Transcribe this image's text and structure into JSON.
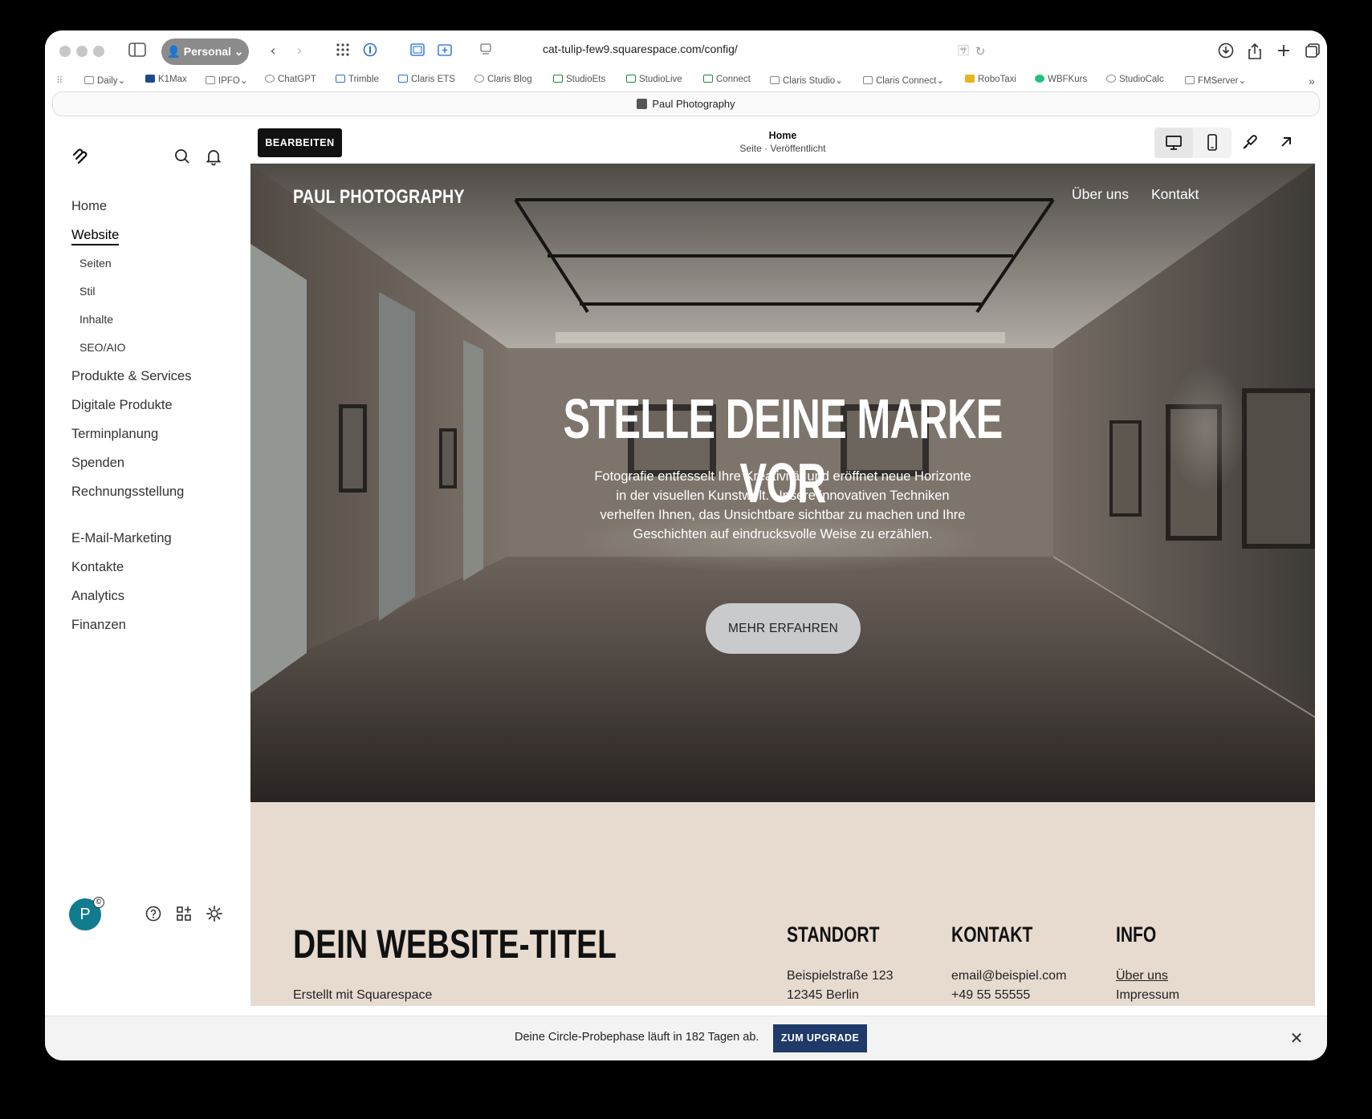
{
  "browser": {
    "profile_label": "Personal",
    "url": "cat-tulip-few9.squarespace.com/config/",
    "tab_title": "Paul Photography",
    "bookmarks": [
      "Daily",
      "K1Max",
      "IPFO",
      "ChatGPT",
      "Trimble",
      "Claris ETS",
      "Claris Blog",
      "StudioEts",
      "StudioLive",
      "Connect",
      "Claris Studio",
      "Claris Connect",
      "RoboTaxi",
      "WBFKurs",
      "StudioCalc",
      "FMServer"
    ]
  },
  "sidebar": {
    "items": [
      "Home",
      "Website",
      "Produkte & Services",
      "Digitale Produkte",
      "Terminplanung",
      "Spenden",
      "Rechnungsstellung",
      "E-Mail-Marketing",
      "Kontakte",
      "Analytics",
      "Finanzen"
    ],
    "sub_items": [
      "Seiten",
      "Stil",
      "Inhalte",
      "SEO/AIO"
    ],
    "avatar_letter": "P"
  },
  "editor": {
    "edit_label": "BEARBEITEN",
    "page_title": "Home",
    "page_status": "Seite · Veröffentlicht"
  },
  "site": {
    "brand": "PAUL PHOTOGRAPHY",
    "nav": [
      "Über uns",
      "Kontakt"
    ],
    "hero_title": "STELLE DEINE MARKE VOR",
    "hero_text": "Fotografie entfesselt Ihre Kreativität und eröffnet neue Horizonte in der visuellen Kunstwelt. Unsere innovativen Techniken verhelfen Ihnen, das Unsichtbare sichtbar zu machen und Ihre Geschichten auf eindrucksvolle Weise zu erzählen.",
    "hero_button": "MEHR ERFAHREN",
    "footer": {
      "title": "DEIN WEBSITE-TITEL",
      "subtitle": "Erstellt mit Squarespace",
      "location_heading": "STANDORT",
      "location_line1": "Beispielstraße 123",
      "location_line2": "12345 Berlin",
      "contact_heading": "KONTAKT",
      "contact_email": "email@beispiel.com",
      "contact_phone": "+49 55 55555",
      "info_heading": "INFO",
      "info_link1": "Über uns",
      "info_link2": "Impressum"
    }
  },
  "upgrade_bar": {
    "text": "Deine Circle-Probephase läuft in 182 Tagen ab.",
    "button": "ZUM UPGRADE"
  },
  "colors": {
    "upgrade_button": "#1f3a68",
    "avatar": "#117c8e",
    "footer_bg": "#e7dbd0",
    "hero_button": "#c9cacc"
  }
}
